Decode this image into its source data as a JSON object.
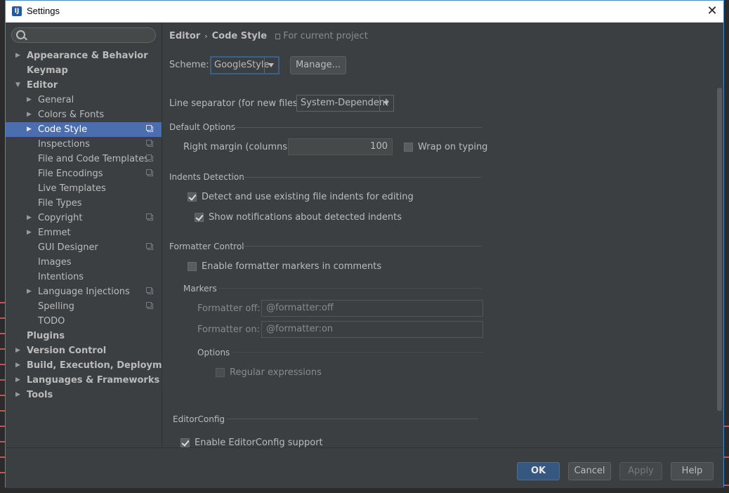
{
  "window": {
    "title": "Settings",
    "icon_letters": "IJ"
  },
  "search": {
    "placeholder": ""
  },
  "sidebar": {
    "items": [
      {
        "label": "Appearance & Behavior",
        "level": 0,
        "bold": true,
        "arrow": "right",
        "project": false,
        "selected": false
      },
      {
        "label": "Keymap",
        "level": 0,
        "bold": true,
        "arrow": "",
        "project": false,
        "selected": false
      },
      {
        "label": "Editor",
        "level": 0,
        "bold": true,
        "arrow": "down",
        "project": false,
        "selected": false
      },
      {
        "label": "General",
        "level": 1,
        "bold": false,
        "arrow": "right",
        "project": false,
        "selected": false
      },
      {
        "label": "Colors & Fonts",
        "level": 1,
        "bold": false,
        "arrow": "right",
        "project": false,
        "selected": false
      },
      {
        "label": "Code Style",
        "level": 1,
        "bold": false,
        "arrow": "right",
        "project": true,
        "selected": true
      },
      {
        "label": "Inspections",
        "level": 1,
        "bold": false,
        "arrow": "",
        "project": true,
        "selected": false
      },
      {
        "label": "File and Code Templates",
        "level": 1,
        "bold": false,
        "arrow": "",
        "project": true,
        "selected": false
      },
      {
        "label": "File Encodings",
        "level": 1,
        "bold": false,
        "arrow": "",
        "project": true,
        "selected": false
      },
      {
        "label": "Live Templates",
        "level": 1,
        "bold": false,
        "arrow": "",
        "project": false,
        "selected": false
      },
      {
        "label": "File Types",
        "level": 1,
        "bold": false,
        "arrow": "",
        "project": false,
        "selected": false
      },
      {
        "label": "Copyright",
        "level": 1,
        "bold": false,
        "arrow": "right",
        "project": true,
        "selected": false
      },
      {
        "label": "Emmet",
        "level": 1,
        "bold": false,
        "arrow": "right",
        "project": false,
        "selected": false
      },
      {
        "label": "GUI Designer",
        "level": 1,
        "bold": false,
        "arrow": "",
        "project": true,
        "selected": false
      },
      {
        "label": "Images",
        "level": 1,
        "bold": false,
        "arrow": "",
        "project": false,
        "selected": false
      },
      {
        "label": "Intentions",
        "level": 1,
        "bold": false,
        "arrow": "",
        "project": false,
        "selected": false
      },
      {
        "label": "Language Injections",
        "level": 1,
        "bold": false,
        "arrow": "right",
        "project": true,
        "selected": false
      },
      {
        "label": "Spelling",
        "level": 1,
        "bold": false,
        "arrow": "",
        "project": true,
        "selected": false
      },
      {
        "label": "TODO",
        "level": 1,
        "bold": false,
        "arrow": "",
        "project": false,
        "selected": false
      },
      {
        "label": "Plugins",
        "level": 0,
        "bold": true,
        "arrow": "",
        "project": false,
        "selected": false
      },
      {
        "label": "Version Control",
        "level": 0,
        "bold": true,
        "arrow": "right",
        "project": false,
        "selected": false
      },
      {
        "label": "Build, Execution, Deployment",
        "level": 0,
        "bold": true,
        "arrow": "right",
        "project": false,
        "selected": false
      },
      {
        "label": "Languages & Frameworks",
        "level": 0,
        "bold": true,
        "arrow": "right",
        "project": false,
        "selected": false
      },
      {
        "label": "Tools",
        "level": 0,
        "bold": true,
        "arrow": "right",
        "project": false,
        "selected": false
      }
    ]
  },
  "breadcrumb": {
    "parent": "Editor",
    "separator": "›",
    "current": "Code Style",
    "note": "For current project"
  },
  "scheme": {
    "label": "Scheme:",
    "value": "GoogleStyle",
    "manage_label": "Manage..."
  },
  "line_separator": {
    "label": "Line separator (for new files):",
    "value": "System-Dependent"
  },
  "default_options": {
    "title": "Default Options",
    "right_margin_label": "Right margin (columns):",
    "right_margin_value": "100",
    "wrap_label": "Wrap on typing",
    "wrap_checked": false
  },
  "indents": {
    "title": "Indents Detection",
    "detect_label": "Detect and use existing file indents for editing",
    "detect_checked": true,
    "notify_label": "Show notifications about detected indents",
    "notify_checked": true
  },
  "formatter": {
    "title": "Formatter Control",
    "enable_label": "Enable formatter markers in comments",
    "enable_checked": false,
    "markers_title": "Markers",
    "off_label": "Formatter off:",
    "off_value": "@formatter:off",
    "on_label": "Formatter on:",
    "on_value": "@formatter:on",
    "options_title": "Options",
    "regex_label": "Regular expressions",
    "regex_checked": false
  },
  "editorconfig": {
    "title": "EditorConfig",
    "enable_label": "Enable EditorConfig support",
    "enable_checked": true
  },
  "footer": {
    "ok": "OK",
    "cancel": "Cancel",
    "apply": "Apply",
    "help": "Help"
  },
  "colors": {
    "accent": "#4b6eaf",
    "background": "#3c3f41",
    "text": "#bbbbbb",
    "primary_button": "#365880"
  }
}
